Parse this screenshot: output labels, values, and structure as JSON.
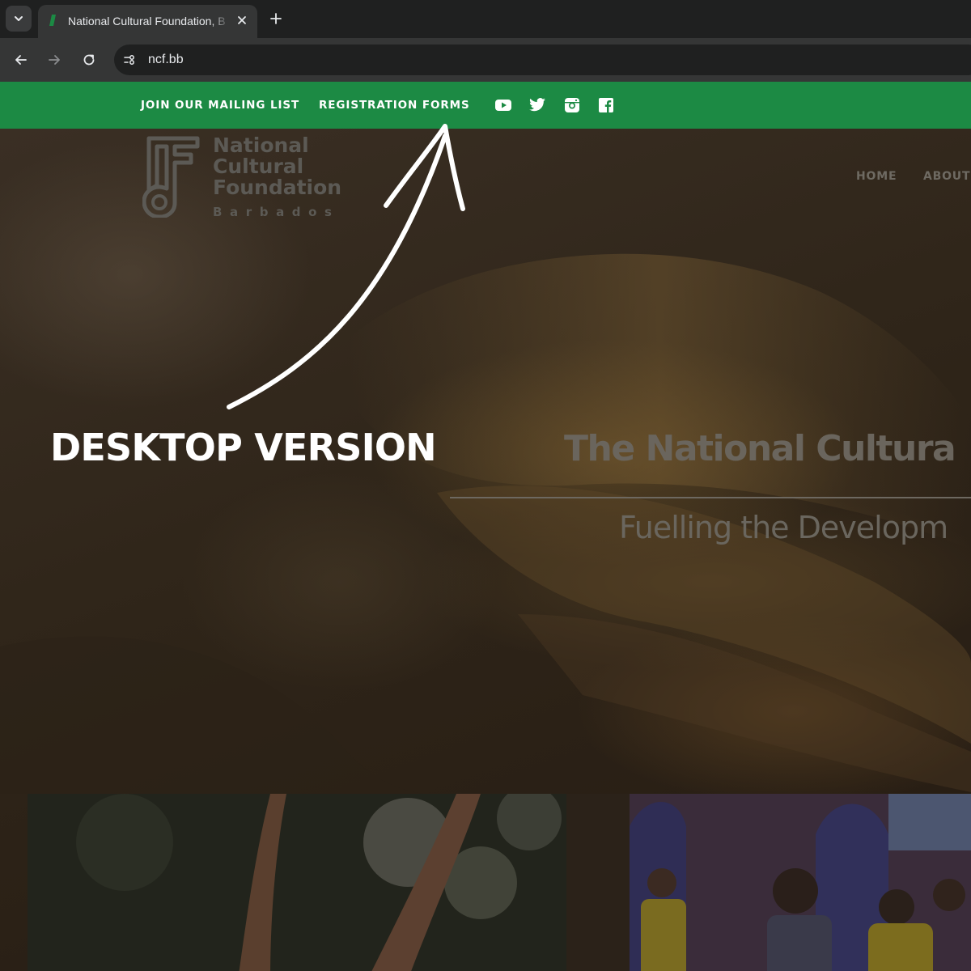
{
  "browser": {
    "tab_title": "National Cultural Foundation, B",
    "url": "ncf.bb"
  },
  "site": {
    "top_links": [
      "JOIN OUR MAILING LIST",
      "REGISTRATION FORMS"
    ],
    "social": [
      "youtube-icon",
      "twitter-icon",
      "instagram-icon",
      "facebook-icon"
    ],
    "logo": {
      "lines": [
        "National",
        "Cultural",
        "Foundation"
      ],
      "sub": "Barbados",
      "mark": "NCF"
    },
    "nav": [
      "HOME",
      "ABOUT"
    ],
    "hero_title": "The National Cultura",
    "hero_subtitle": "Fuelling the Developm"
  },
  "annotation": {
    "label": "DESKTOP VERSION"
  },
  "colors": {
    "topbar_green": "#1c8a44",
    "chrome_dark": "#1f2020",
    "chrome_tab": "#353636"
  }
}
